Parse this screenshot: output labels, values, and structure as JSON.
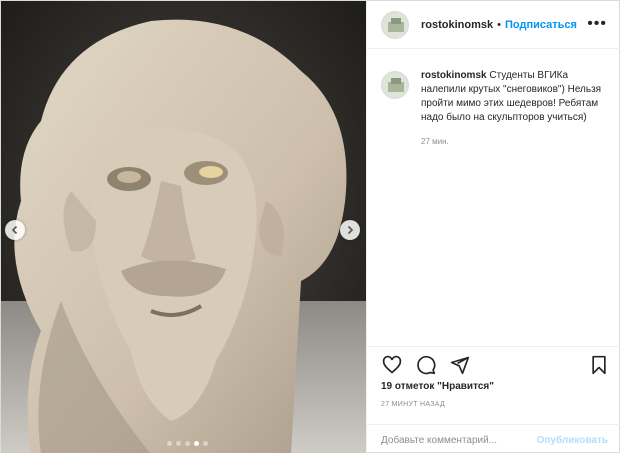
{
  "header": {
    "username": "rostokinomsk",
    "separator": "•",
    "follow_label": "Подписаться",
    "more_label": "•••"
  },
  "caption": {
    "username": "rostokinomsk",
    "text": "Студенты ВГИКа налепили крутых \"снеговиков\") Нельзя пройти мимо этих шедевров! Ребятам надо было на скульпторов учиться)",
    "time": "27 мин."
  },
  "actions": {
    "icons": [
      "heart-icon",
      "comment-icon",
      "share-icon",
      "bookmark-icon"
    ],
    "likes": "19 отметок \"Нравится\"",
    "post_time": "27 МИНУТ НАЗАД"
  },
  "comment_box": {
    "placeholder": "Добавьте комментарий...",
    "publish_label": "Опубликовать"
  },
  "carousel": {
    "slides": 5,
    "active_index": 3
  },
  "colors": {
    "accent": "#0095f6",
    "publish_disabled": "#b2dffc",
    "muted": "#8e8e8e"
  }
}
